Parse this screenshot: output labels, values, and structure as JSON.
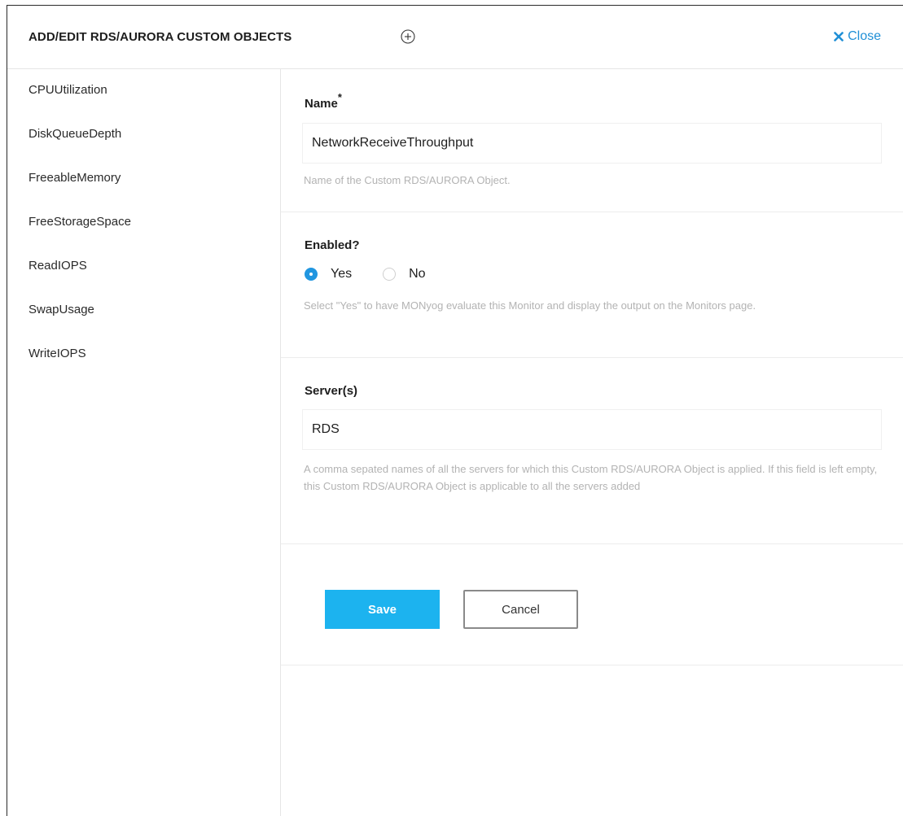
{
  "header": {
    "title": "ADD/EDIT RDS/AURORA CUSTOM OBJECTS",
    "close_label": "Close"
  },
  "sidebar": {
    "items": [
      {
        "label": "CPUUtilization"
      },
      {
        "label": "DiskQueueDepth"
      },
      {
        "label": "FreeableMemory"
      },
      {
        "label": "FreeStorageSpace"
      },
      {
        "label": "ReadIOPS"
      },
      {
        "label": "SwapUsage"
      },
      {
        "label": "WriteIOPS"
      }
    ]
  },
  "form": {
    "name": {
      "label": "Name",
      "required_mark": "*",
      "value": "NetworkReceiveThroughput",
      "help": "Name of the Custom RDS/AURORA Object."
    },
    "enabled": {
      "label": "Enabled?",
      "options": [
        {
          "label": "Yes",
          "selected": true
        },
        {
          "label": "No",
          "selected": false
        }
      ],
      "help": "Select \"Yes\" to have MONyog evaluate this Monitor and display the output on the Monitors page."
    },
    "servers": {
      "label": "Server(s)",
      "value": "RDS",
      "help": "A comma sepated names of all the servers for which this Custom RDS/AURORA Object is applied. If this field is left empty, this Custom RDS/AURORA Object is applicable to all the servers added"
    }
  },
  "actions": {
    "save_label": "Save",
    "cancel_label": "Cancel"
  },
  "colors": {
    "accent": "#1cb3ef",
    "link": "#1f8fd6",
    "radio_selected": "#2196e0",
    "help_text": "#b3b3b3"
  },
  "icons": {
    "add": "plus-circle-icon",
    "close": "x-icon",
    "radio_on": "radio-checked-icon",
    "radio_off": "radio-unchecked-icon"
  }
}
